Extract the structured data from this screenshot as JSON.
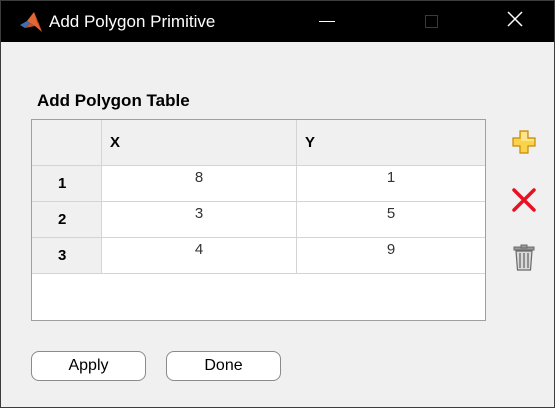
{
  "window": {
    "title": "Add Polygon Primitive",
    "controls": {
      "minimize": "—",
      "close": "✕"
    }
  },
  "table": {
    "title": "Add Polygon Table",
    "columns": [
      "X",
      "Y"
    ],
    "rows": [
      {
        "label": "1",
        "x": "8",
        "y": "1"
      },
      {
        "label": "2",
        "x": "3",
        "y": "5"
      },
      {
        "label": "3",
        "x": "4",
        "y": "9"
      }
    ]
  },
  "side_actions": [
    {
      "name": "add-icon",
      "color": "#f2b705"
    },
    {
      "name": "delete-icon",
      "color": "#e81123"
    },
    {
      "name": "trash-icon",
      "color": "#8a8a8a"
    }
  ],
  "buttons": {
    "apply": "Apply",
    "done": "Done"
  }
}
